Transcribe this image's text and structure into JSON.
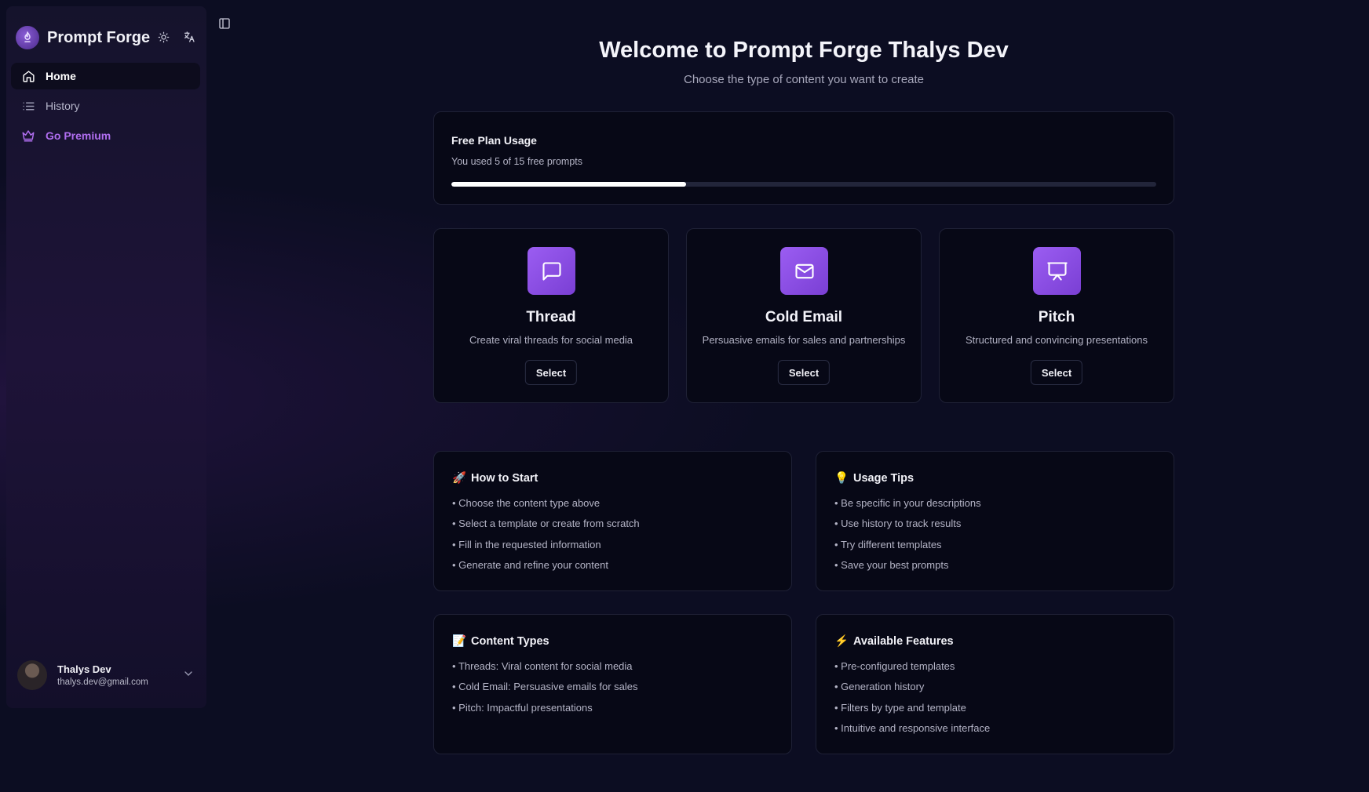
{
  "app": {
    "title": "Prompt Forge"
  },
  "sidebar": {
    "items": [
      {
        "label": "Home",
        "icon": "home-icon"
      },
      {
        "label": "History",
        "icon": "list-icon"
      },
      {
        "label": "Go Premium",
        "icon": "crown-icon"
      }
    ],
    "user": {
      "name": "Thalys Dev",
      "email": "thalys.dev@gmail.com"
    }
  },
  "main": {
    "welcome": "Welcome to Prompt Forge Thalys Dev",
    "subtitle": "Choose the type of content you want to create",
    "usage": {
      "title": "Free Plan Usage",
      "text": "You used 5 of 15 free prompts",
      "used": 5,
      "total": 15
    },
    "content_types": [
      {
        "title": "Thread",
        "description": "Create viral threads for social media",
        "button": "Select",
        "icon": "message-square-icon"
      },
      {
        "title": "Cold Email",
        "description": "Persuasive emails for sales and partnerships",
        "button": "Select",
        "icon": "mail-icon"
      },
      {
        "title": "Pitch",
        "description": "Structured and convincing presentations",
        "button": "Select",
        "icon": "presentation-icon"
      }
    ],
    "info_cards": [
      {
        "emoji": "🚀",
        "title": "How to Start",
        "items": [
          "Choose the content type above",
          "Select a template or create from scratch",
          "Fill in the requested information",
          "Generate and refine your content"
        ]
      },
      {
        "emoji": "💡",
        "title": "Usage Tips",
        "items": [
          "Be specific in your descriptions",
          "Use history to track results",
          "Try different templates",
          "Save your best prompts"
        ]
      },
      {
        "emoji": "📝",
        "title": "Content Types",
        "items": [
          "Threads: Viral content for social media",
          "Cold Email: Persuasive emails for sales",
          "Pitch: Impactful presentations"
        ]
      },
      {
        "emoji": "⚡",
        "title": "Available Features",
        "items": [
          "Pre-configured templates",
          "Generation history",
          "Filters by type and template",
          "Intuitive and responsive interface"
        ]
      }
    ]
  },
  "colors": {
    "accent": "#9b5df2",
    "premium": "#b06ef0",
    "background": "#0c0d22"
  }
}
